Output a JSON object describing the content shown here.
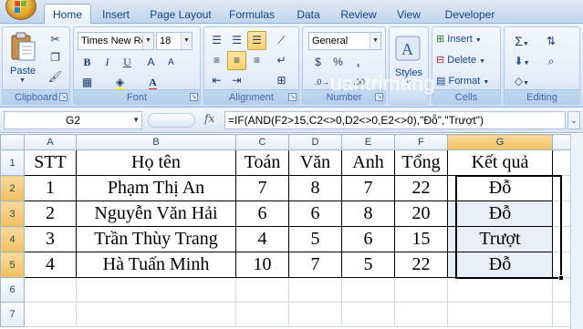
{
  "tabs": [
    "Home",
    "Insert",
    "Page Layout",
    "Formulas",
    "Data",
    "Review",
    "View",
    "Developer"
  ],
  "ribbon": {
    "clipboard": {
      "paste": "Paste",
      "label": "Clipboard"
    },
    "font": {
      "name": "Times New Ro",
      "size": "18",
      "bold": "B",
      "italic": "I",
      "underline": "U",
      "grow": "A",
      "shrink": "A",
      "label": "Font"
    },
    "alignment": {
      "label": "Alignment"
    },
    "number": {
      "format": "General",
      "currency": "$",
      "percent": "%",
      "comma": ",",
      "inc": ".0→",
      "dec": "←.00",
      "label": "Number"
    },
    "styles": {
      "button": "Styles"
    },
    "cells": {
      "insert": "Insert",
      "delete": "Delete",
      "format": "Format",
      "label": "Cells"
    },
    "editing": {
      "sum": "Σ",
      "label": "Editing"
    }
  },
  "watermark": "uantrimang",
  "formula_bar": {
    "name_box": "G2",
    "fx": "fx",
    "formula": "=IF(AND(F2>15,C2<>0,D2<>0,E2<>0),\"Đỗ\",\"Trượt\")"
  },
  "sheet": {
    "columns": [
      "A",
      "B",
      "C",
      "D",
      "E",
      "F",
      "G"
    ],
    "rows": [
      "1",
      "2",
      "3",
      "4",
      "5",
      "6",
      "7"
    ],
    "header": [
      "STT",
      "Họ tên",
      "Toán",
      "Văn",
      "Anh",
      "Tổng",
      "Kết quả"
    ],
    "data": [
      [
        "1",
        "Phạm Thị An",
        "7",
        "8",
        "7",
        "22",
        "Đỗ"
      ],
      [
        "2",
        "Nguyễn Văn Hải",
        "6",
        "6",
        "8",
        "20",
        "Đỗ"
      ],
      [
        "3",
        "Trần Thùy Trang",
        "4",
        "5",
        "6",
        "15",
        "Trượt"
      ],
      [
        "4",
        "Hà Tuấn Minh",
        "10",
        "7",
        "5",
        "22",
        "Đỗ"
      ]
    ]
  },
  "colors": {
    "ribbon_accent": "#15428b",
    "selection_fill": "#e8edf6",
    "active_header": "#f1c15f"
  }
}
